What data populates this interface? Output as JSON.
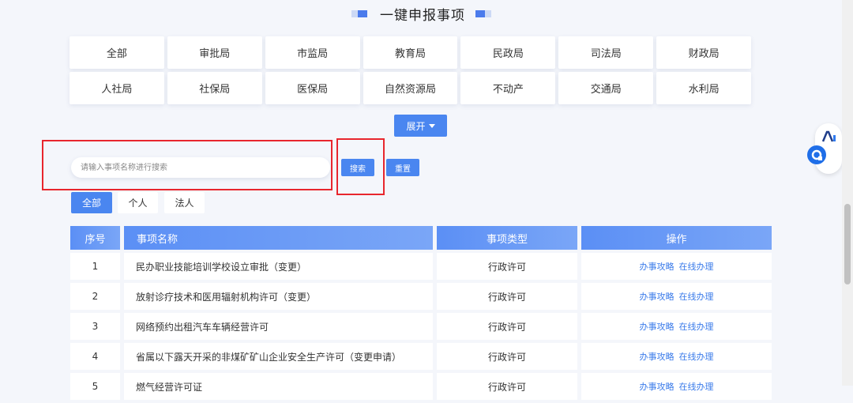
{
  "page": {
    "title": "一键申报事项"
  },
  "departments": {
    "row1": [
      "全部",
      "审批局",
      "市监局",
      "教育局",
      "民政局",
      "司法局",
      "财政局"
    ],
    "row2": [
      "人社局",
      "社保局",
      "医保局",
      "自然资源局",
      "不动产",
      "交通局",
      "水利局"
    ],
    "expand_label": "展开"
  },
  "search": {
    "placeholder": "请输入事项名称进行搜索",
    "search_label": "搜索",
    "reset_label": "重置"
  },
  "type_tabs": {
    "all": "全部",
    "personal": "个人",
    "legal": "法人",
    "selected": "全部"
  },
  "table": {
    "headers": {
      "no": "序号",
      "name": "事项名称",
      "type": "事项类型",
      "action": "操作"
    },
    "rows": [
      {
        "no": "1",
        "name": "民办职业技能培训学校设立审批（变更）",
        "type": "行政许可",
        "guide": "办事攻略",
        "online": "在线办理"
      },
      {
        "no": "2",
        "name": "放射诊疗技术和医用辐射机构许可（变更）",
        "type": "行政许可",
        "guide": "办事攻略",
        "online": "在线办理"
      },
      {
        "no": "3",
        "name": "网络预约出租汽车车辆经营许可",
        "type": "行政许可",
        "guide": "办事攻略",
        "online": "在线办理"
      },
      {
        "no": "4",
        "name": "省属以下露天开采的非煤矿矿山企业安全生产许可（变更申请）",
        "type": "行政许可",
        "guide": "办事攻略",
        "online": "在线办理"
      },
      {
        "no": "5",
        "name": "燃气经营许可证",
        "type": "行政许可",
        "guide": "办事攻略",
        "online": "在线办理"
      }
    ]
  },
  "colors": {
    "accent": "#4a86f0",
    "highlight_border": "#e8262d"
  }
}
